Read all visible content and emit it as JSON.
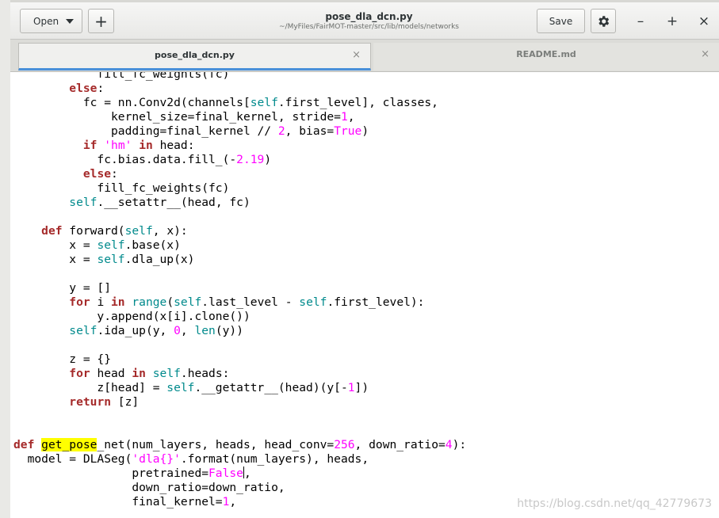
{
  "window": {
    "title": "pose_dla_dcn.py",
    "subtitle": "~/MyFiles/FairMOT-master/src/lib/models/networks"
  },
  "header": {
    "open_label": "Open",
    "new_tab_label": "+",
    "save_label": "Save",
    "minimize_label": "–",
    "maximize_label": "+",
    "close_label": "×"
  },
  "tabs": [
    {
      "label": "pose_dla_dcn.py",
      "active": true,
      "close": "×"
    },
    {
      "label": "README.md",
      "active": false,
      "close": "×"
    }
  ],
  "editor": {
    "lines": [
      "            fill_fc_weights(fc)",
      "        else:",
      "          fc = nn.Conv2d(channels[self.first_level], classes,",
      "              kernel_size=final_kernel, stride=1,",
      "              padding=final_kernel // 2, bias=True)",
      "          if 'hm' in head:",
      "            fc.bias.data.fill_(-2.19)",
      "          else:",
      "            fill_fc_weights(fc)",
      "        self.__setattr__(head, fc)",
      "",
      "    def forward(self, x):",
      "        x = self.base(x)",
      "        x = self.dla_up(x)",
      "",
      "        y = []",
      "        for i in range(self.last_level - self.first_level):",
      "            y.append(x[i].clone())",
      "        self.ida_up(y, 0, len(y))",
      "",
      "        z = {}",
      "        for head in self.heads:",
      "            z[head] = self.__getattr__(head)(y[-1])",
      "        return [z]",
      "",
      "",
      "def get_pose_net(num_layers, heads, head_conv=256, down_ratio=4):",
      "  model = DLASeg('dla{}'.format(num_layers), heads,",
      "                 pretrained=False,",
      "                 down_ratio=down_ratio,",
      "                 final_kernel=1,"
    ],
    "highlighted_word": "get_pose"
  },
  "watermark": "https://blog.csdn.net/qq_42779673",
  "colors": {
    "keyword": "#a52a2a",
    "self": "#008a8c",
    "number": "#ff00ff",
    "string": "#ff00ff",
    "search_highlight": "#ffff00",
    "active_tab_indicator": "#4a90d9"
  }
}
